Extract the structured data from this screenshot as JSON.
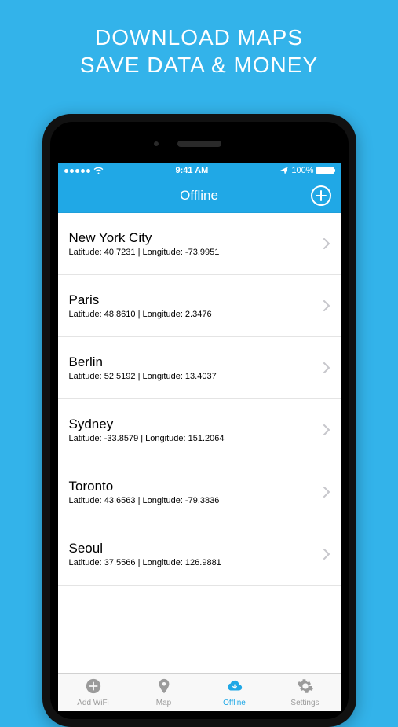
{
  "promo": {
    "line1": "DOWNLOAD MAPS",
    "line2": "SAVE DATA & MONEY"
  },
  "status": {
    "time": "9:41 AM",
    "battery_pct": "100%"
  },
  "nav": {
    "title": "Offline"
  },
  "cities": [
    {
      "name": "New York City",
      "sub": "Latitude: 40.7231 | Longitude: -73.9951"
    },
    {
      "name": "Paris",
      "sub": "Latitude: 48.8610 | Longitude: 2.3476"
    },
    {
      "name": "Berlin",
      "sub": "Latitude: 52.5192 | Longitude: 13.4037"
    },
    {
      "name": "Sydney",
      "sub": "Latitude: -33.8579 | Longitude: 151.2064"
    },
    {
      "name": "Toronto",
      "sub": "Latitude: 43.6563 | Longitude: -79.3836"
    },
    {
      "name": "Seoul",
      "sub": "Latitude: 37.5566 | Longitude: 126.9881"
    }
  ],
  "tabs": [
    {
      "id": "add-wifi",
      "label": "Add WiFi",
      "active": false
    },
    {
      "id": "map",
      "label": "Map",
      "active": false
    },
    {
      "id": "offline",
      "label": "Offline",
      "active": true
    },
    {
      "id": "settings",
      "label": "Settings",
      "active": false
    }
  ]
}
